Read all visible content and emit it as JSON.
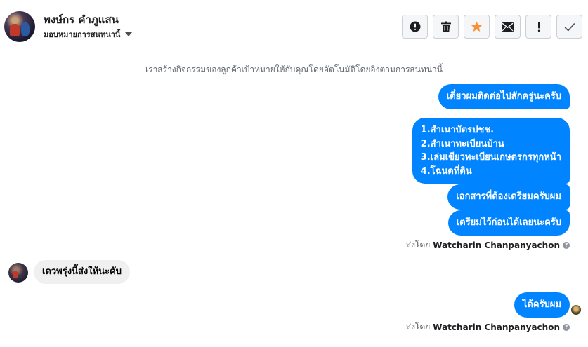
{
  "header": {
    "contact_name": "พงษ์กร คำภูแสน",
    "assign_label": "มอบหมายการสนทนานี้"
  },
  "toolbar": {
    "buttons": [
      {
        "icon": "alert-circle-icon",
        "name": "report-button"
      },
      {
        "icon": "trash-icon",
        "name": "delete-button"
      },
      {
        "icon": "star-icon",
        "name": "star-button",
        "color": "#f7923b"
      },
      {
        "icon": "envelope-icon",
        "name": "mark-unread-button"
      },
      {
        "icon": "exclamation-icon",
        "name": "spam-button"
      },
      {
        "icon": "check-icon",
        "name": "done-button"
      }
    ]
  },
  "conversation": {
    "auto_note": "เราสร้างกิจกรรมของลูกค้าเป้าหมายให้กับคุณโดยอัตโนมัติโดยอิงตามการสนทนานี้",
    "messages_out_1": {
      "m1": "เดี๋ยวผมติดต่อไปสักครู่นะครับ",
      "m2_lines": [
        "1.สำเนาบัตรปชช.",
        "2.สำเนาทะเบียนบ้าน",
        "3.เล่มเขียวทะเบียนเกษตรกรทุกหน้า",
        "4.โฉนดที่ดิน"
      ],
      "m3": "เอกสารที่ต้องเตรียมครับผม",
      "m4": "เตรียมไว้ก่อนได้เลยนะครับ"
    },
    "sent_by_prefix": "ส่งโดย",
    "sent_by_name": "Watcharin Chanpanyachon",
    "message_in": "เดวพรุ่งนี้ส่งให้นะคับ",
    "messages_out_2": {
      "m1": "ได้ครับผม"
    }
  },
  "colors": {
    "outgoing_bubble": "#0084ff",
    "incoming_bubble": "#f0f0f0",
    "star": "#f7923b"
  }
}
